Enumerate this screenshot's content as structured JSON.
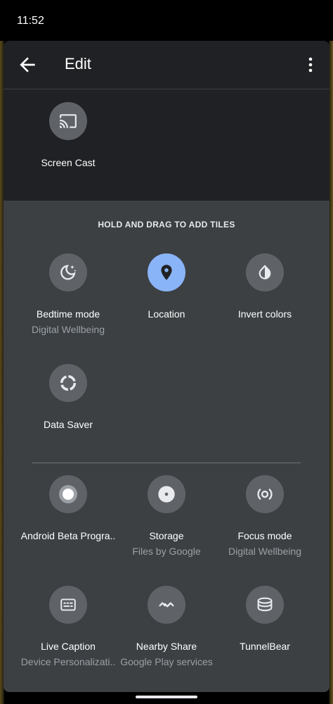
{
  "status_bar": {
    "time": "11:52"
  },
  "toolbar": {
    "title": "Edit",
    "back_icon": "arrow-left-icon",
    "more_icon": "more-vert-icon"
  },
  "current_tiles": [
    {
      "label": "Screen Cast",
      "icon": "cast-icon"
    }
  ],
  "available_section": {
    "hint": "HOLD AND DRAG TO ADD TILES",
    "tiles": [
      {
        "label": "Bedtime mode",
        "sub": "Digital Wellbeing",
        "icon": "bedtime-moon-icon"
      },
      {
        "label": "Location",
        "sub": "",
        "icon": "location-pin-icon",
        "active": true,
        "active_color": "#8ab4f8"
      },
      {
        "label": "Invert colors",
        "sub": "",
        "icon": "invert-colors-icon"
      },
      {
        "label": "Data Saver",
        "sub": "",
        "icon": "data-saver-icon"
      }
    ],
    "app_tiles": [
      {
        "label": "Android Beta Progra..",
        "sub": "",
        "icon": "android-beta-icon"
      },
      {
        "label": "Storage",
        "sub": "Files by Google",
        "icon": "storage-disc-icon"
      },
      {
        "label": "Focus mode",
        "sub": "Digital Wellbeing",
        "icon": "focus-mode-icon"
      },
      {
        "label": "Live Caption",
        "sub": "Device Personalizati..",
        "icon": "live-caption-icon"
      },
      {
        "label": "Nearby Share",
        "sub": "Google Play services",
        "icon": "nearby-share-icon"
      },
      {
        "label": "TunnelBear",
        "sub": "",
        "icon": "tunnelbear-icon"
      }
    ]
  }
}
